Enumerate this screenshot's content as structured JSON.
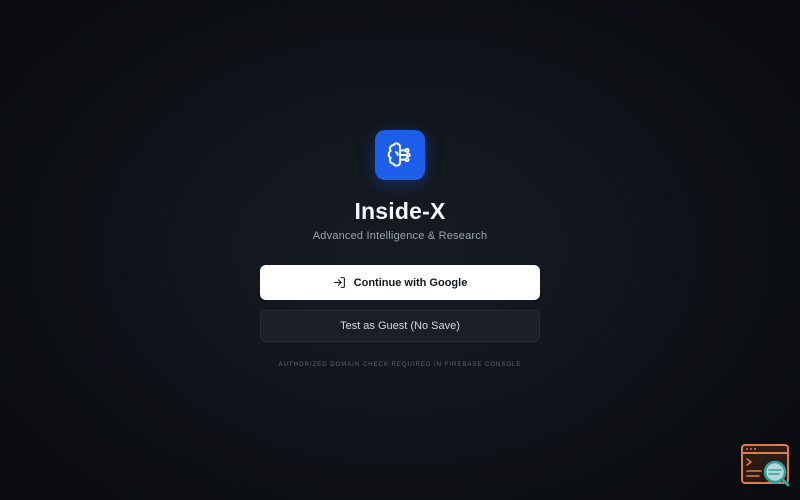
{
  "app": {
    "title": "Inside-X",
    "subtitle": "Advanced Intelligence & Research",
    "logo_icon": "brain-circuit-icon"
  },
  "actions": {
    "google_label": "Continue with Google",
    "google_icon": "sign-in-icon",
    "guest_label": "Test as Guest (No Save)"
  },
  "footer": {
    "note": "AUTHORIZED DOMAIN CHECK REQUIRED IN FIREBASE CONSOLE"
  },
  "overlay": {
    "widget_icon": "browser-inspect-icon"
  },
  "colors": {
    "accent": "#1d5fe8",
    "background": "#12161d",
    "primary_button": "#ffffff",
    "secondary_button": "#1a1f27",
    "widget_orange": "#e07b4a",
    "widget_teal": "#2aa3a0"
  }
}
